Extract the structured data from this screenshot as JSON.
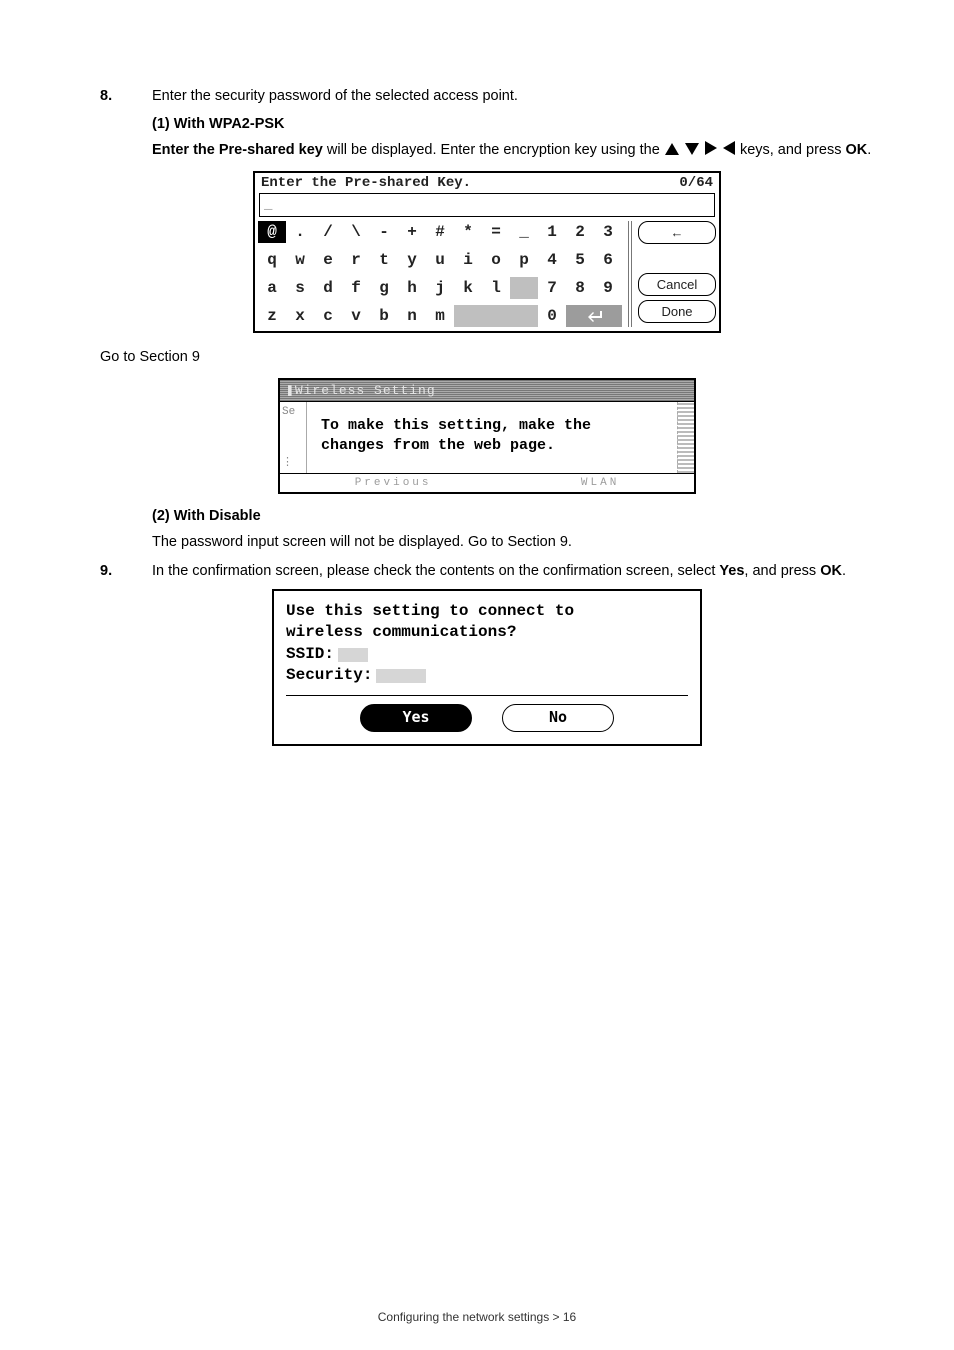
{
  "step8": {
    "num": "8.",
    "text": "Enter the security password of the selected access point."
  },
  "sec1": {
    "heading": "(1) With WPA2-PSK",
    "lead_bold": "Enter the Pre-shared key",
    "lead_rest": " will be displayed. Enter the encryption key using the ",
    "tail": " keys, and press ",
    "ok": "OK",
    "period": "."
  },
  "kb": {
    "title": "Enter the Pre-shared Key.",
    "counter": "0/64",
    "cursor": "_",
    "row1": [
      "@",
      ".",
      "/",
      "\\",
      "-",
      "+",
      "#",
      "*",
      "=",
      "_",
      "1",
      "2",
      "3"
    ],
    "row2": [
      "q",
      "w",
      "e",
      "r",
      "t",
      "y",
      "u",
      "i",
      "o",
      "p",
      "4",
      "5",
      "6"
    ],
    "row3": [
      "a",
      "s",
      "d",
      "f",
      "g",
      "h",
      "j",
      "k",
      "l",
      "",
      "7",
      "8",
      "9"
    ],
    "row4": [
      "z",
      "x",
      "c",
      "v",
      "b",
      "n",
      "m",
      "",
      "",
      "",
      "0",
      "",
      ""
    ],
    "side": {
      "back": "←",
      "blank": "",
      "cancel": "Cancel",
      "done": "Done"
    }
  },
  "goto": "Go to Section 9",
  "ws": {
    "title": "❚Wireless Setting",
    "left_top": "Se",
    "msg1": "To make this setting, make the",
    "msg2": "changes from the web page.",
    "foot_left": "Previous",
    "foot_right": "WLAN"
  },
  "sec2": {
    "heading": "(2) With Disable",
    "text": "The password input screen will not be displayed. Go to Section 9."
  },
  "step9": {
    "num": "9.",
    "text_a": "In the confirmation screen, please check the contents on the confirmation screen, select ",
    "yes": "Yes",
    "text_b": ", and press ",
    "ok": "OK",
    "period": "."
  },
  "conf": {
    "line1": "Use this setting to connect to",
    "line2": "wireless communications?",
    "ssid_label": "SSID:",
    "sec_label": "Security:",
    "yes": "Yes",
    "no": "No"
  },
  "footer": "Configuring the network settings > 16"
}
